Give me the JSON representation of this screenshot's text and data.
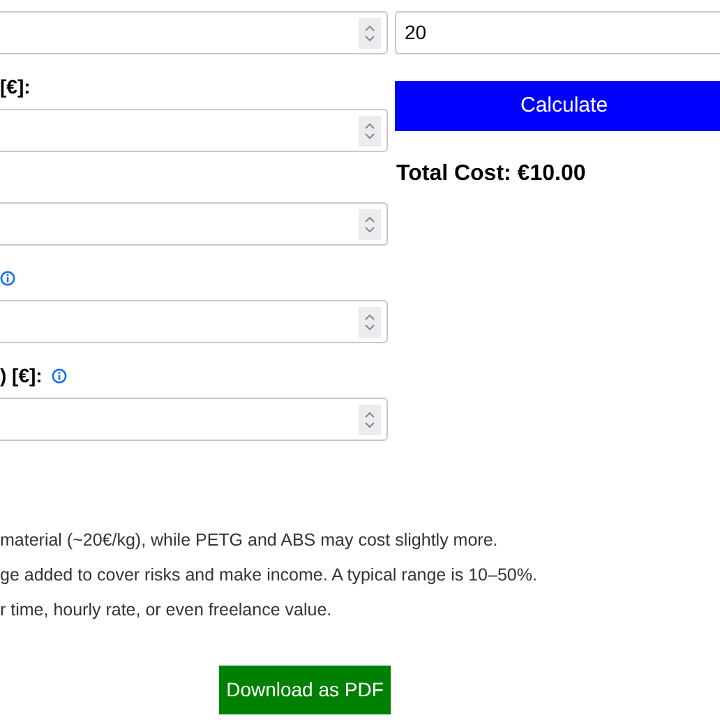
{
  "left_fields": [
    {
      "info": false
    },
    {
      "label": "[€]:",
      "info": false
    },
    {
      "info": false
    },
    {
      "info": true
    },
    {
      "label": ") [€]:",
      "info": true
    }
  ],
  "profit_margin": {
    "value": "20"
  },
  "calculate_button": "Calculate",
  "total_cost": "Total Cost: €10.00",
  "notes": [
    "material (~20€/kg), while PETG and ABS may cost slightly more.",
    "ge added to cover risks and make income. A typical range is 10–50%.",
    "r time, hourly rate, or even freelance value."
  ],
  "download_button": "Download as PDF"
}
